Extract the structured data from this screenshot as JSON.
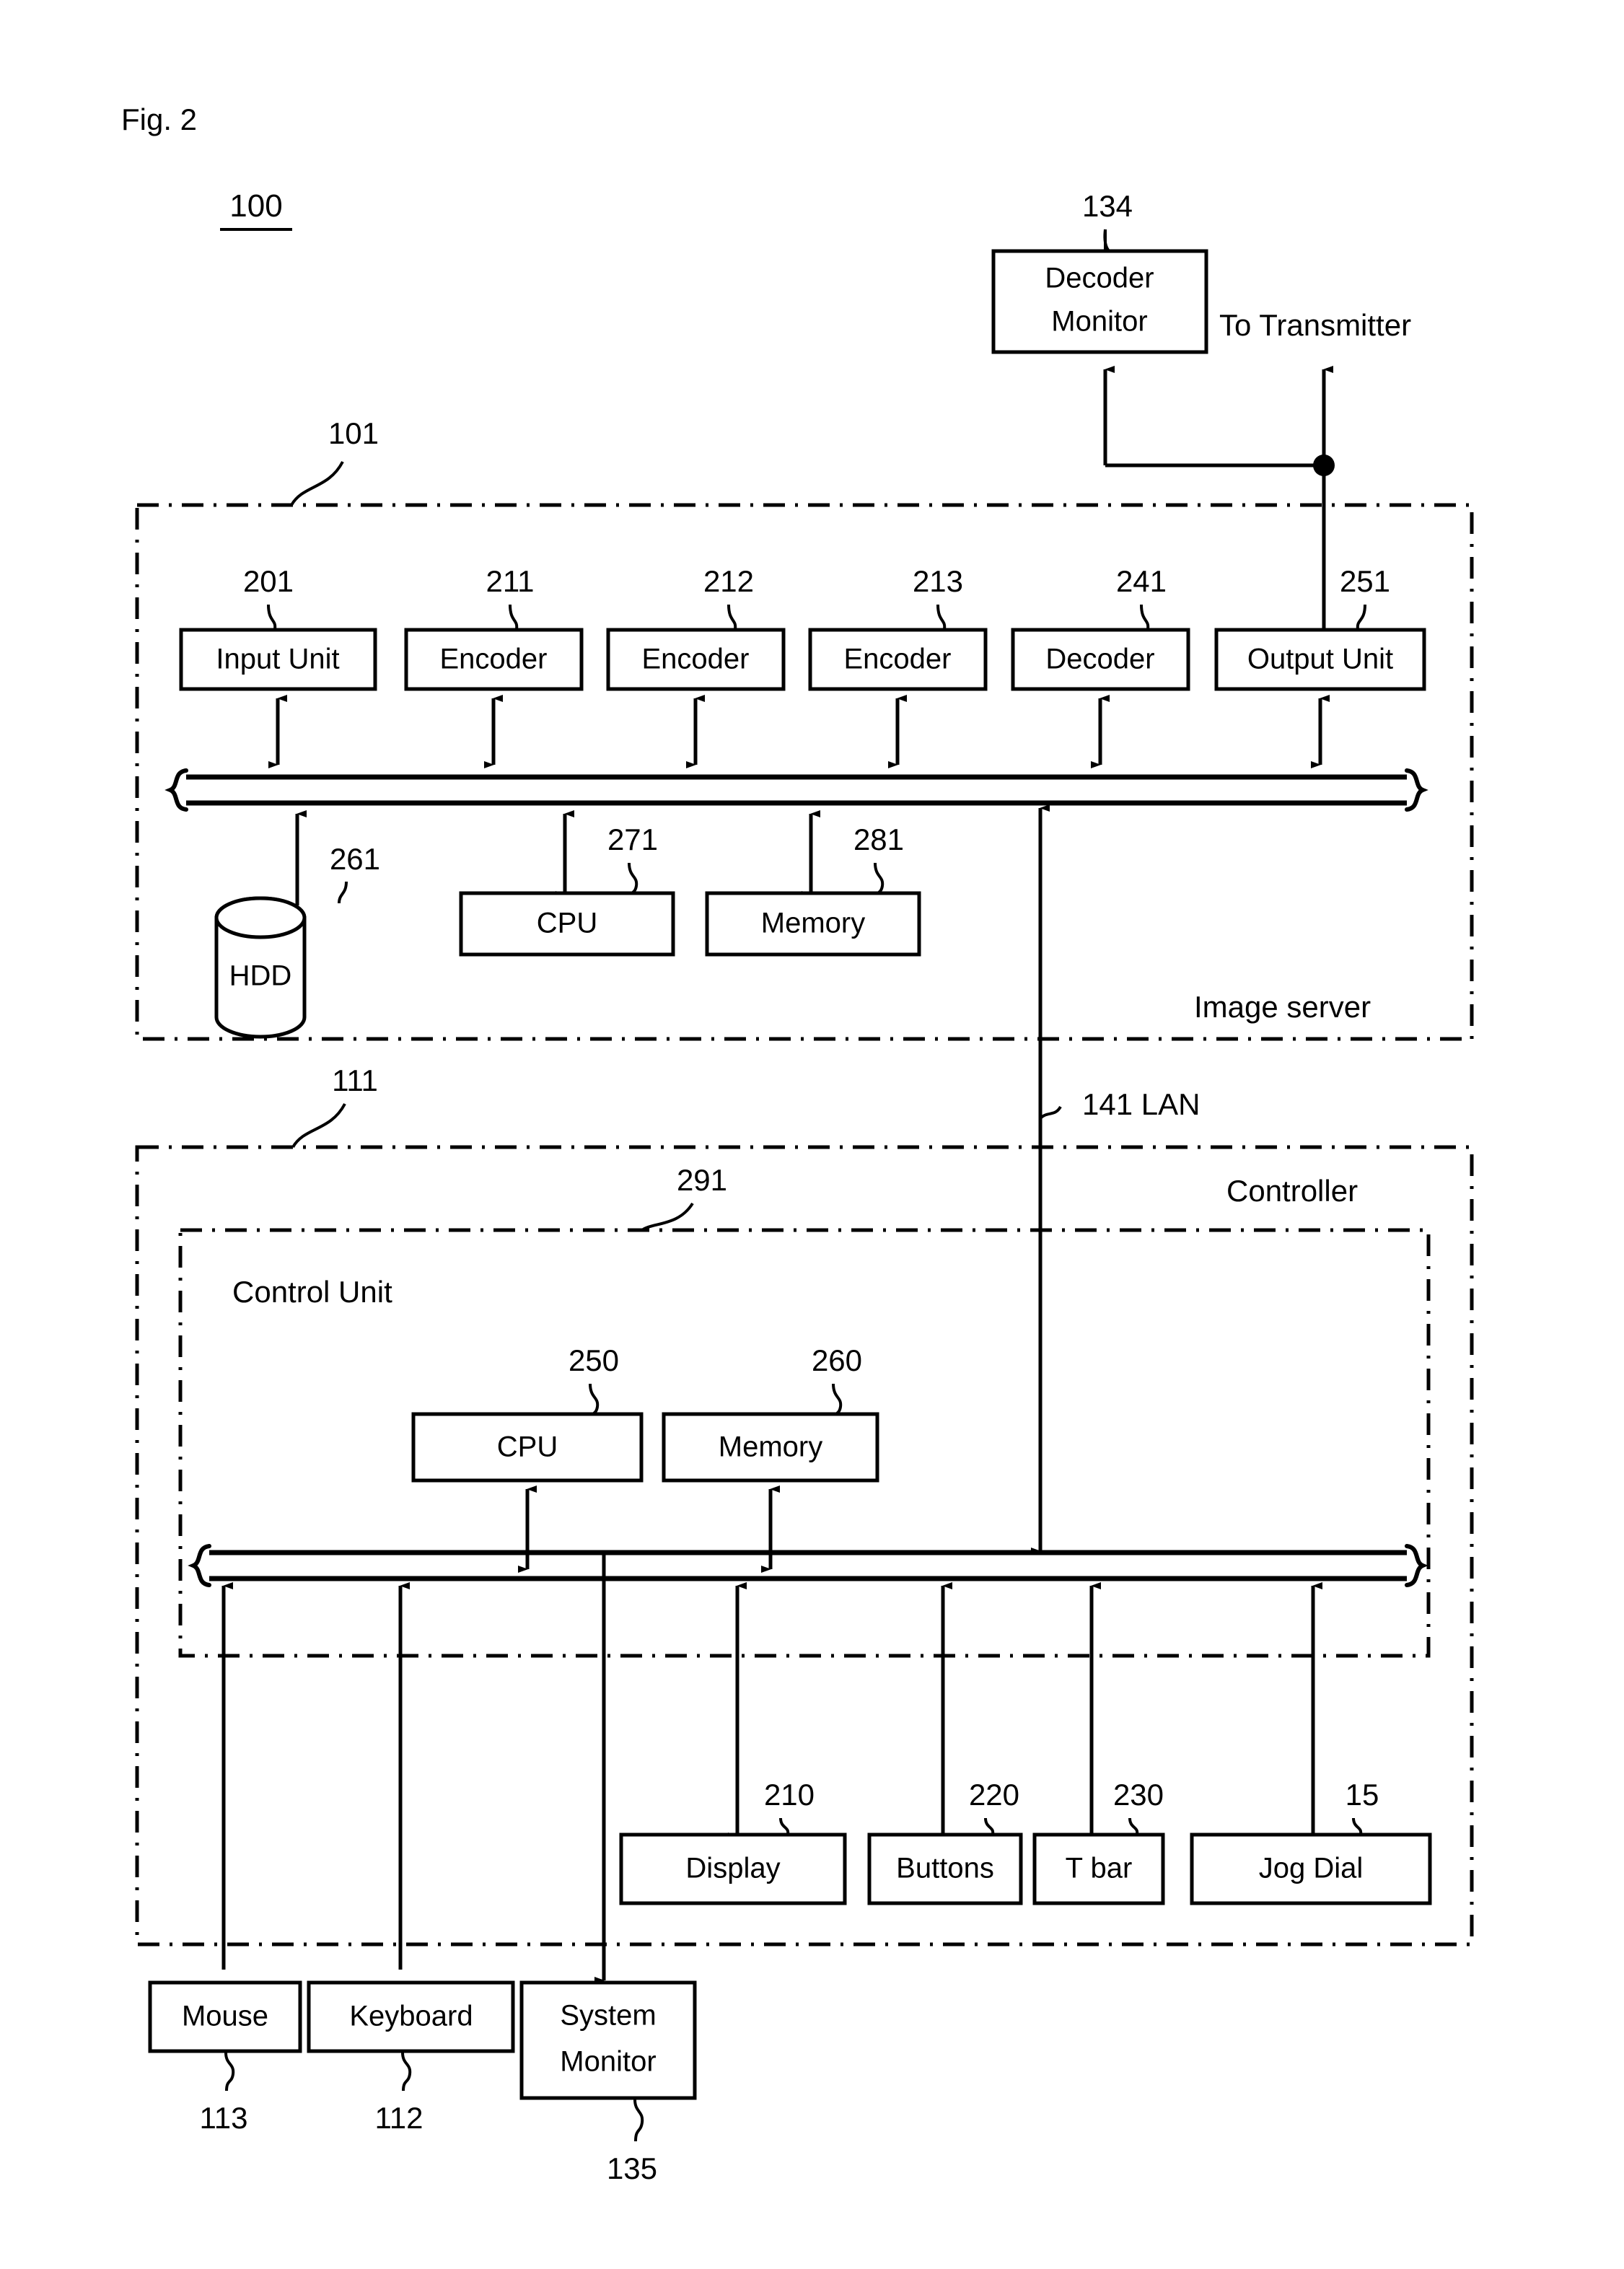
{
  "figure": {
    "title": "Fig. 2",
    "system_number": "100"
  },
  "external": {
    "decoder_monitor": {
      "label_line1": "Decoder",
      "label_line2": "Monitor",
      "ref": "134"
    },
    "to_transmitter": {
      "label": "To Transmitter"
    }
  },
  "image_server": {
    "ref": "101",
    "region_label": "Image server",
    "top_row": [
      {
        "label": "Input Unit",
        "ref": "201"
      },
      {
        "label": "Encoder",
        "ref": "211"
      },
      {
        "label": "Encoder",
        "ref": "212"
      },
      {
        "label": "Encoder",
        "ref": "213"
      },
      {
        "label": "Decoder",
        "ref": "241"
      },
      {
        "label": "Output Unit",
        "ref": "251"
      }
    ],
    "bottom_row": [
      {
        "label": "HDD",
        "ref": "261",
        "shape": "cylinder"
      },
      {
        "label": "CPU",
        "ref": "271",
        "shape": "rect"
      },
      {
        "label": "Memory",
        "ref": "281",
        "shape": "rect"
      }
    ]
  },
  "lan": {
    "ref": "141",
    "label": "141 LAN"
  },
  "controller": {
    "ref": "111",
    "region_label": "Controller",
    "control_unit": {
      "ref": "291",
      "region_label": "Control Unit",
      "core": [
        {
          "label": "CPU",
          "ref": "250"
        },
        {
          "label": "Memory",
          "ref": "260"
        }
      ]
    },
    "peripherals": [
      {
        "label": "Display",
        "ref": "210"
      },
      {
        "label": "Buttons",
        "ref": "220"
      },
      {
        "label": "T bar",
        "ref": "230"
      },
      {
        "label": "Jog Dial",
        "ref": "15"
      }
    ]
  },
  "external_io": [
    {
      "label": "Mouse",
      "ref": "113"
    },
    {
      "label": "Keyboard",
      "ref": "112"
    },
    {
      "label_line1": "System",
      "label_line2": "Monitor",
      "ref": "135"
    }
  ],
  "colors": {
    "ink": "#000000",
    "paper": "#ffffff"
  }
}
